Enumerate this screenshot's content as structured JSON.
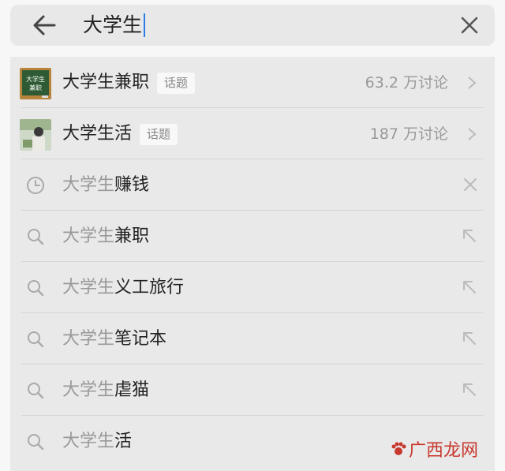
{
  "search": {
    "query": "大学生"
  },
  "topics": [
    {
      "title": "大学生兼职",
      "tag": "话题",
      "count": "63.2 万讨论",
      "thumb_icon": "chalkboard-thumb",
      "thumb_text": [
        "大学生",
        "兼职"
      ]
    },
    {
      "title": "大学生活",
      "tag": "话题",
      "count": "187 万讨论",
      "thumb_icon": "photo-thumb"
    }
  ],
  "history": [
    {
      "prefix": "大学生",
      "suffix": "赚钱",
      "icon": "clock-icon"
    }
  ],
  "suggestions": [
    {
      "prefix": "大学生",
      "suffix": "兼职"
    },
    {
      "prefix": "大学生",
      "suffix": "义工旅行"
    },
    {
      "prefix": "大学生",
      "suffix": "笔记本"
    },
    {
      "prefix": "大学生",
      "suffix": "虐猫"
    },
    {
      "prefix": "大学生",
      "suffix": "活"
    }
  ],
  "watermark": {
    "text": "广西龙网"
  },
  "colors": {
    "caret": "#2d7be5",
    "watermark": "#c7382d",
    "chalkboard": "#2e5b33"
  }
}
